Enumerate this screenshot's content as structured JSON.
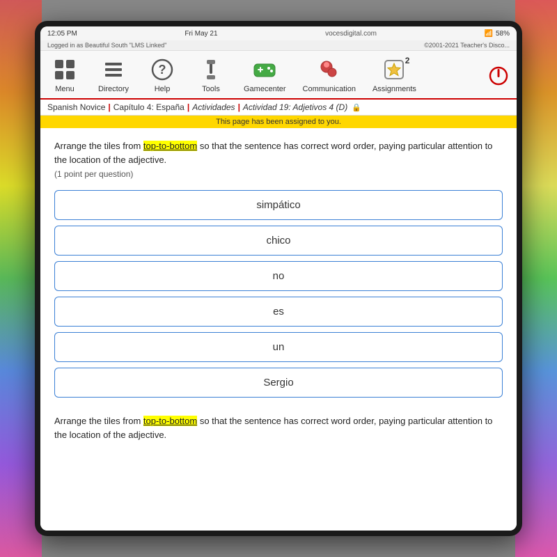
{
  "status": {
    "time": "12:05 PM",
    "date": "Fri May 21",
    "url": "vocesdigital.com",
    "battery": "58%",
    "logged_in": "Logged in as Beautiful South \"LMS Linked\"",
    "copyright": "©2001-2021 Teacher's Disco..."
  },
  "nav": {
    "items": [
      {
        "id": "menu",
        "label": "Menu",
        "icon": "grid-icon"
      },
      {
        "id": "directory",
        "label": "Directory",
        "icon": "list-icon"
      },
      {
        "id": "help",
        "label": "Help",
        "icon": "question-icon"
      },
      {
        "id": "tools",
        "label": "Tools",
        "icon": "tools-icon"
      },
      {
        "id": "gamecenter",
        "label": "Gamecenter",
        "icon": "game-icon"
      },
      {
        "id": "communication",
        "label": "Communication",
        "icon": "comm-icon"
      },
      {
        "id": "assignments",
        "label": "Assignments",
        "icon": "star-icon",
        "badge": "2"
      }
    ],
    "power_label": "⏻"
  },
  "breadcrumb": {
    "items": [
      {
        "id": "spanish-novice",
        "label": "Spanish Novice",
        "italic": false
      },
      {
        "id": "chapter",
        "label": "Capítulo 4: España",
        "italic": false
      },
      {
        "id": "actividades",
        "label": "Actividades",
        "italic": true
      },
      {
        "id": "activity",
        "label": "Actividad 19: Adjetivos 4 (D)",
        "italic": true
      }
    ]
  },
  "assigned_banner": "This page has been assigned to you.",
  "instruction": {
    "text_before": "Arrange the tiles from ",
    "highlight": "top-to-bottom",
    "text_after": " so that the sentence has correct word order, paying particular attention to the location of the adjective.",
    "points": "(1 point per question)"
  },
  "tiles": [
    {
      "id": "tile-1",
      "word": "simpático"
    },
    {
      "id": "tile-2",
      "word": "chico"
    },
    {
      "id": "tile-3",
      "word": "no"
    },
    {
      "id": "tile-4",
      "word": "es"
    },
    {
      "id": "tile-5",
      "word": "un"
    },
    {
      "id": "tile-6",
      "word": "Sergio"
    }
  ],
  "bottom_instruction": {
    "text_before": "Arrange the tiles from ",
    "highlight": "top-to-bottom",
    "text_after": " so that the sentence has correct word order, paying particular attention to the location of the adjective."
  }
}
